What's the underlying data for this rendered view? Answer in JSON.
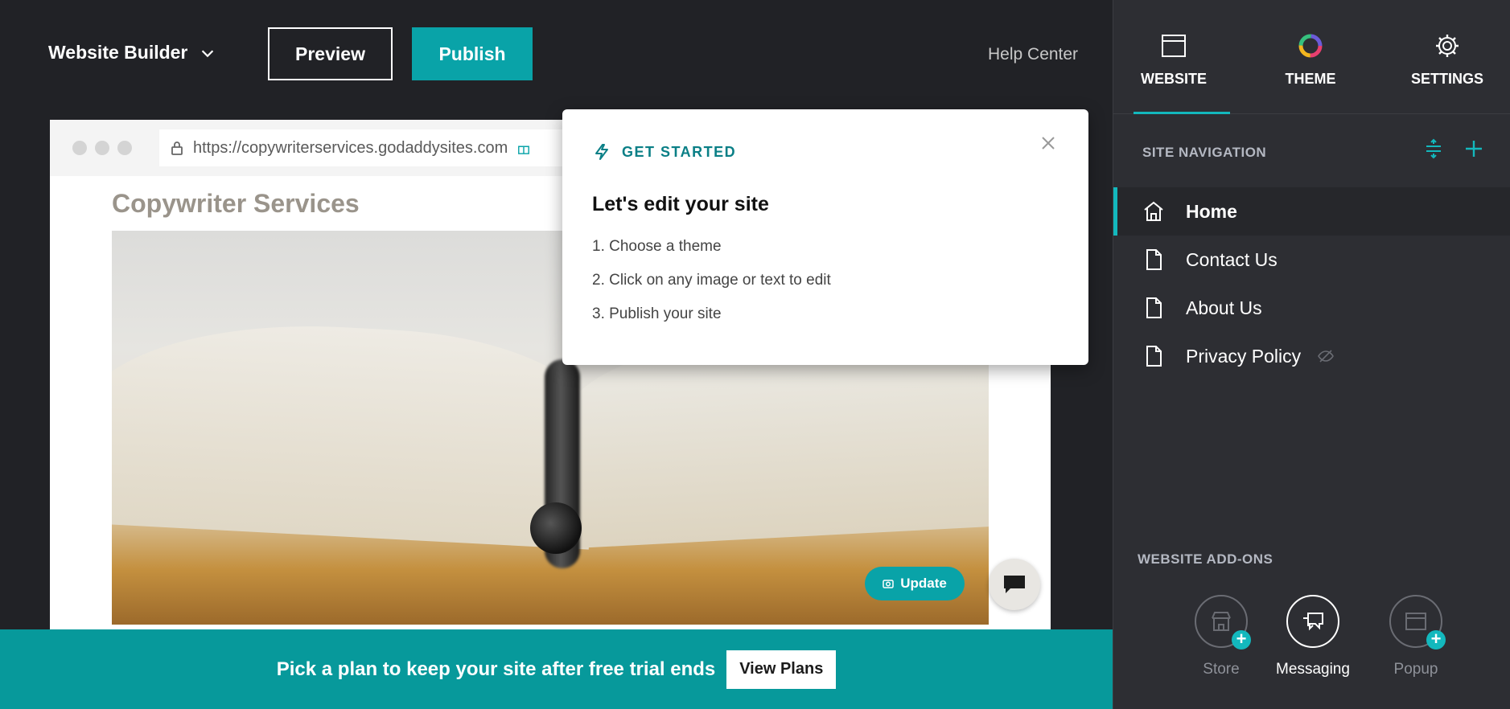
{
  "header": {
    "builder_title": "Website Builder",
    "preview_label": "Preview",
    "publish_label": "Publish",
    "help_label": "Help Center"
  },
  "browser": {
    "url": "https://copywriterservices.godaddysites.com",
    "site_title": "Copywriter Services",
    "update_label": "Update"
  },
  "banner": {
    "text": "Pick a plan to keep your site after free trial ends",
    "button_label": "View Plans"
  },
  "popover": {
    "kicker": "GET STARTED",
    "title": "Let's edit your site",
    "steps": [
      "1. Choose a theme",
      "2. Click on any image or text to edit",
      "3. Publish your site"
    ]
  },
  "panel": {
    "tabs": [
      {
        "label": "WEBSITE",
        "icon": "browser-window-icon",
        "active": true
      },
      {
        "label": "THEME",
        "icon": "color-wheel-icon",
        "active": false
      },
      {
        "label": "SETTINGS",
        "icon": "gear-icon",
        "active": false
      }
    ],
    "site_navigation_label": "SITE NAVIGATION",
    "nav_items": [
      {
        "label": "Home",
        "icon": "home-icon",
        "active": true
      },
      {
        "label": "Contact Us",
        "icon": "page-icon",
        "active": false
      },
      {
        "label": "About Us",
        "icon": "page-icon",
        "active": false
      },
      {
        "label": "Privacy Policy",
        "icon": "page-icon",
        "active": false,
        "hidden": true
      }
    ],
    "addons_label": "WEBSITE ADD-ONS",
    "addons": [
      {
        "label": "Store",
        "icon": "store-icon",
        "enabled": false
      },
      {
        "label": "Messaging",
        "icon": "messaging-icon",
        "enabled": true
      },
      {
        "label": "Popup",
        "icon": "popup-icon",
        "enabled": false
      }
    ]
  },
  "colors": {
    "accent": "#09a3a8",
    "panel_bg": "#2d2e33",
    "app_bg": "#212226",
    "banner_bg": "#07999b"
  }
}
